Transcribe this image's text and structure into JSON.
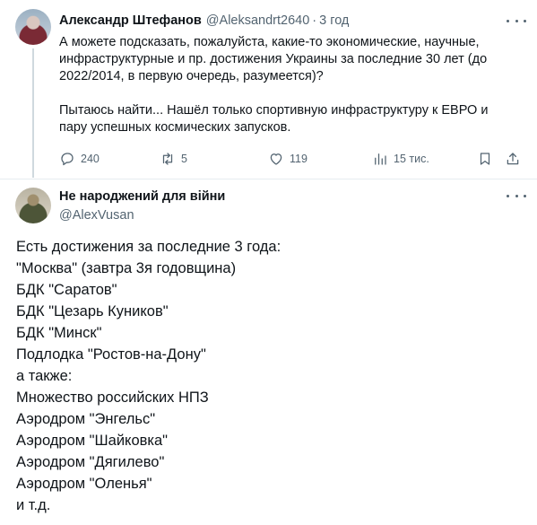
{
  "tweet1": {
    "author_name": "Александр Штефанов",
    "handle": "@Aleksandrt2640",
    "separator": "·",
    "time": "3 год",
    "lines": [
      "А можете подсказать, пожалуйста, какие-то экономические, научные,",
      "инфраструктурные и пр. достижения Украины за последние 30 лет (до",
      "2022/2014, в первую очередь, разумеется)?",
      "",
      "Пытаюсь найти... Нашёл только спортивную инфраструктуру к ЕВРО и",
      "пару успешных космических запусков."
    ],
    "actions": {
      "replies": "240",
      "reposts": "5",
      "likes": "119",
      "views": "15 тис."
    }
  },
  "tweet2": {
    "author_name": "Не народжений для війни",
    "handle": "@AlexVusan",
    "lines": [
      "Есть достижения за последние 3 года:",
      "\"Москва\" (завтра 3я годовщина)",
      "БДК \"Саратов\"",
      "БДК \"Цезарь Куников\"",
      "БДК \"Минск\"",
      "Подлодка \"Ростов-на-Дону\"",
      "а также:",
      "Множество российских НПЗ",
      "Аэродром \"Энгельс\"",
      "Аэродром \"Шайковка\"",
      "Аэродром \"Дягилево\"",
      "Аэродром \"Оленья\"",
      "и т.д."
    ]
  },
  "colors": {
    "text": "#0f1419",
    "secondary": "#536471",
    "divider": "#e6ecf0",
    "thread_line": "#cfd9de"
  }
}
